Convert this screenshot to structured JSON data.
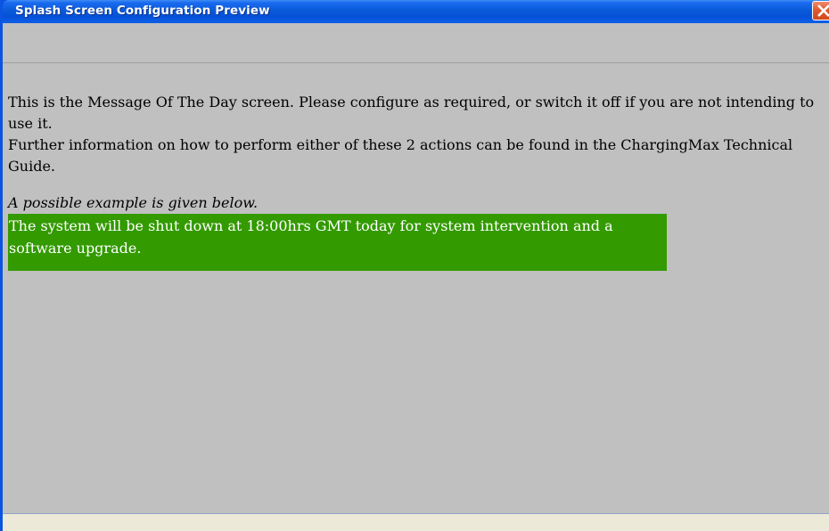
{
  "window": {
    "title": "Splash Screen Configuration Preview",
    "close_icon": "close-x-icon",
    "colors": {
      "titlebar": "#0a5bd9",
      "close_button": "#e05a32",
      "background": "#c0c0c0",
      "message_background": "#339a00",
      "footer": "#ece9d8"
    }
  },
  "content": {
    "intro": "This is the Message Of The Day screen. Please configure as required, or switch it off if you are not intending to use it.",
    "further_info": "Further information on how to perform either of these 2 actions can be found in the ChargingMax Technical Guide.",
    "example_caption": "A possible example is given below.",
    "example_message": "The system will be shut down at 18:00hrs GMT today for system intervention and a software upgrade."
  }
}
